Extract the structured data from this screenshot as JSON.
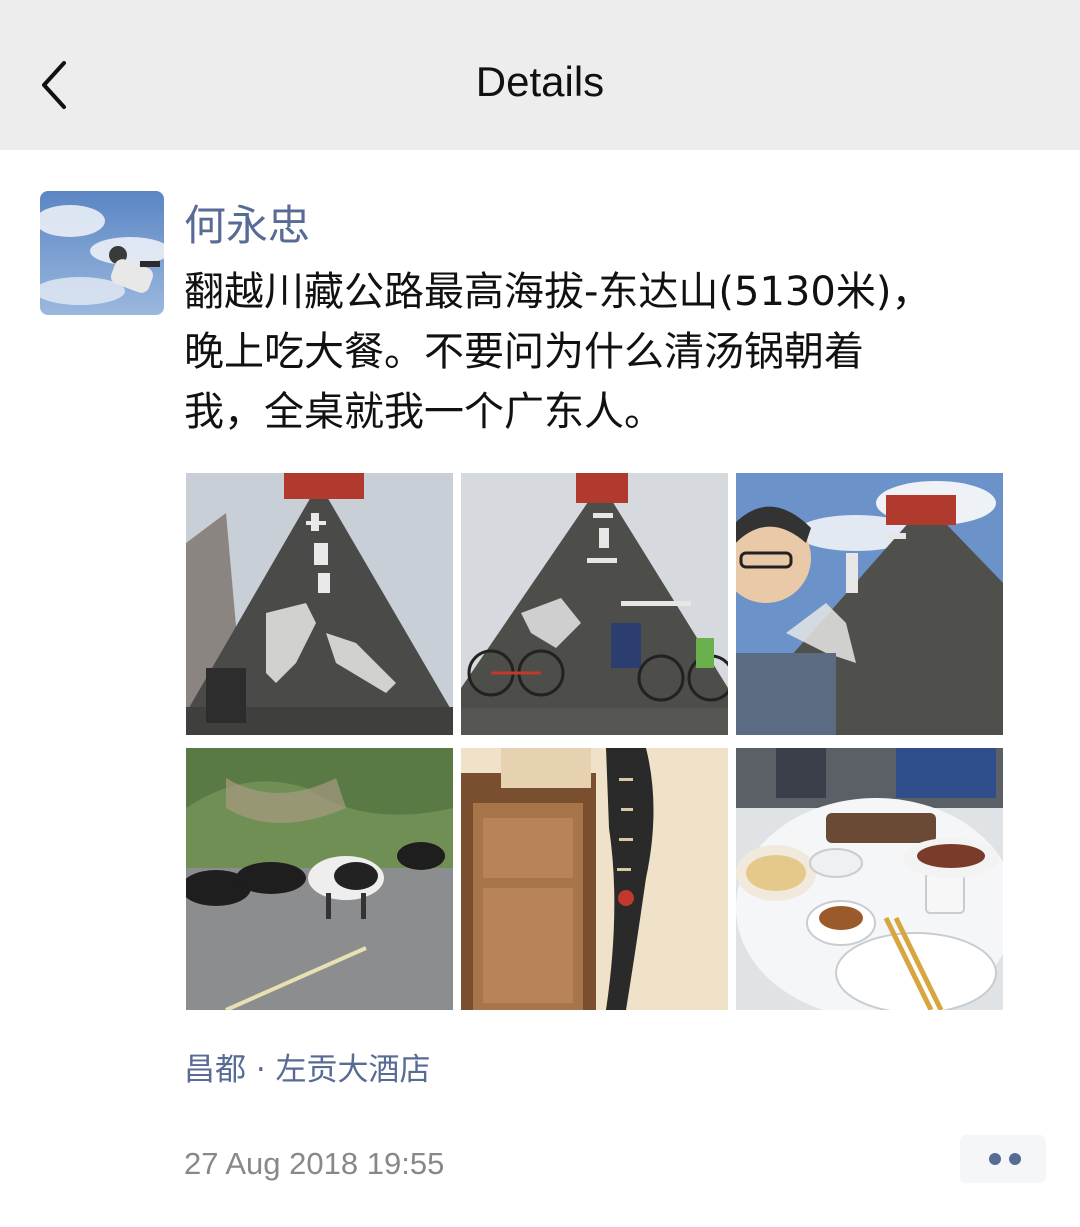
{
  "header": {
    "title": "Details",
    "back_icon": "chevron-left-icon"
  },
  "post": {
    "author": "何永忠",
    "text": "翻越川藏公路最高海拔-东达山(5130米)，\n晚上吃大餐。不要问为什么清汤锅朝着\n我，全桌就我一个广东人。",
    "photos": [
      {
        "name": "pyramid-monument-photo-1"
      },
      {
        "name": "pyramid-monument-bikes-photo"
      },
      {
        "name": "selfie-monument-photo"
      },
      {
        "name": "yaks-on-road-photo"
      },
      {
        "name": "hotel-door-photo"
      },
      {
        "name": "dinner-table-photo"
      }
    ],
    "location": "昌都 · 左贡大酒店",
    "timestamp": "27 Aug 2018 19:55",
    "more_icon": "two-dots-icon"
  },
  "colors": {
    "header_bg": "#ededed",
    "link_blue": "#576b95",
    "timestamp_gray": "#888888"
  }
}
